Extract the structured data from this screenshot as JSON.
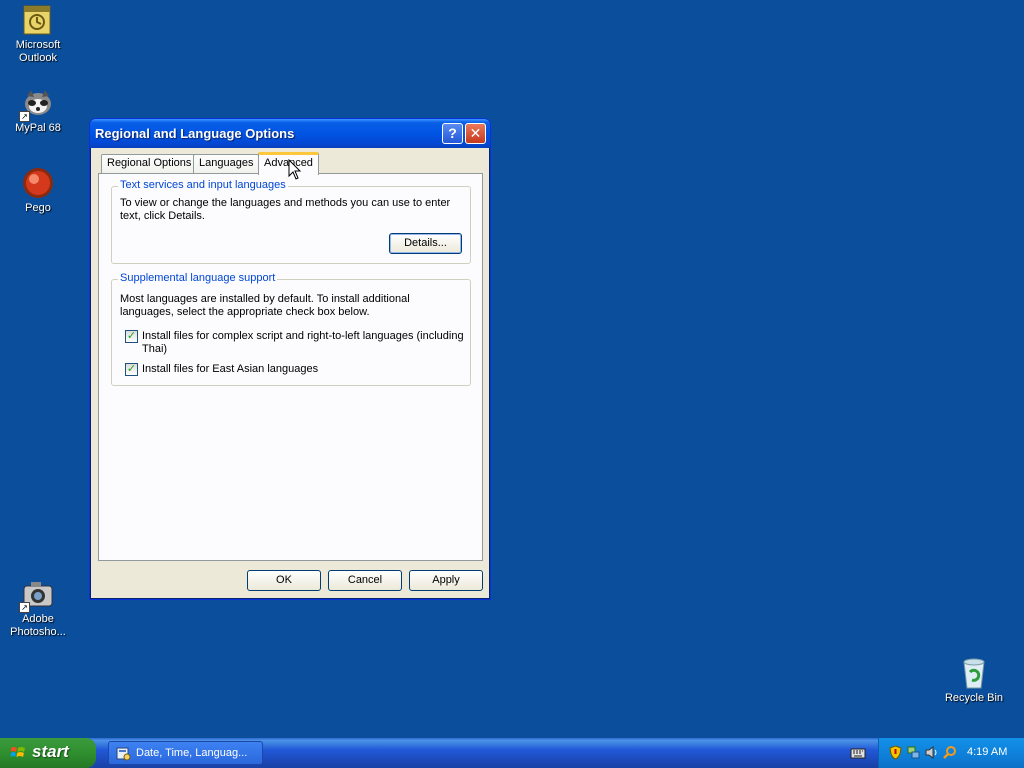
{
  "desktop": {
    "icons": [
      {
        "label": "Microsoft\nOutlook",
        "icon": "outlook-icon"
      },
      {
        "label": "MyPal 68",
        "icon": "mypal-icon"
      },
      {
        "label": "Pego",
        "icon": "pego-icon"
      },
      {
        "label": "Adobe\nPhotosho...",
        "icon": "photoshop-icon"
      },
      {
        "label": "Recycle Bin",
        "icon": "recycle-bin-icon"
      }
    ]
  },
  "dialog": {
    "title": "Regional and Language Options",
    "help_glyph": "?",
    "close_glyph": "✕",
    "tabs": [
      "Regional Options",
      "Languages",
      "Advanced"
    ],
    "active_tab": "Advanced",
    "text_services": {
      "title": "Text services and input languages",
      "description": "To view or change the languages and methods you can use to enter text, click Details.",
      "details_button": "Details..."
    },
    "supplemental": {
      "title": "Supplemental language support",
      "description": "Most languages are installed by default. To install additional languages, select the appropriate check box below.",
      "options": [
        {
          "label": "Install files for complex script and right-to-left languages (including Thai)",
          "checked": true
        },
        {
          "label": "Install files for East Asian languages",
          "checked": true
        }
      ]
    },
    "buttons": {
      "ok": "OK",
      "cancel": "Cancel",
      "apply": "Apply"
    }
  },
  "taskbar": {
    "start_label": "start",
    "tasks": [
      {
        "label": "Date, Time, Languag...",
        "icon": "control-panel-icon"
      }
    ],
    "tray_icons": [
      "security-shield-icon",
      "network-icon",
      "volume-icon",
      "search-icon"
    ],
    "clock": "4:19 AM"
  },
  "colors": {
    "desktop": "#0a4e9c",
    "titlebar": "#0054e3",
    "group_title": "#0046d5",
    "active_tab_accent": "#ffc83c",
    "start_button": "#2f8f2f"
  }
}
